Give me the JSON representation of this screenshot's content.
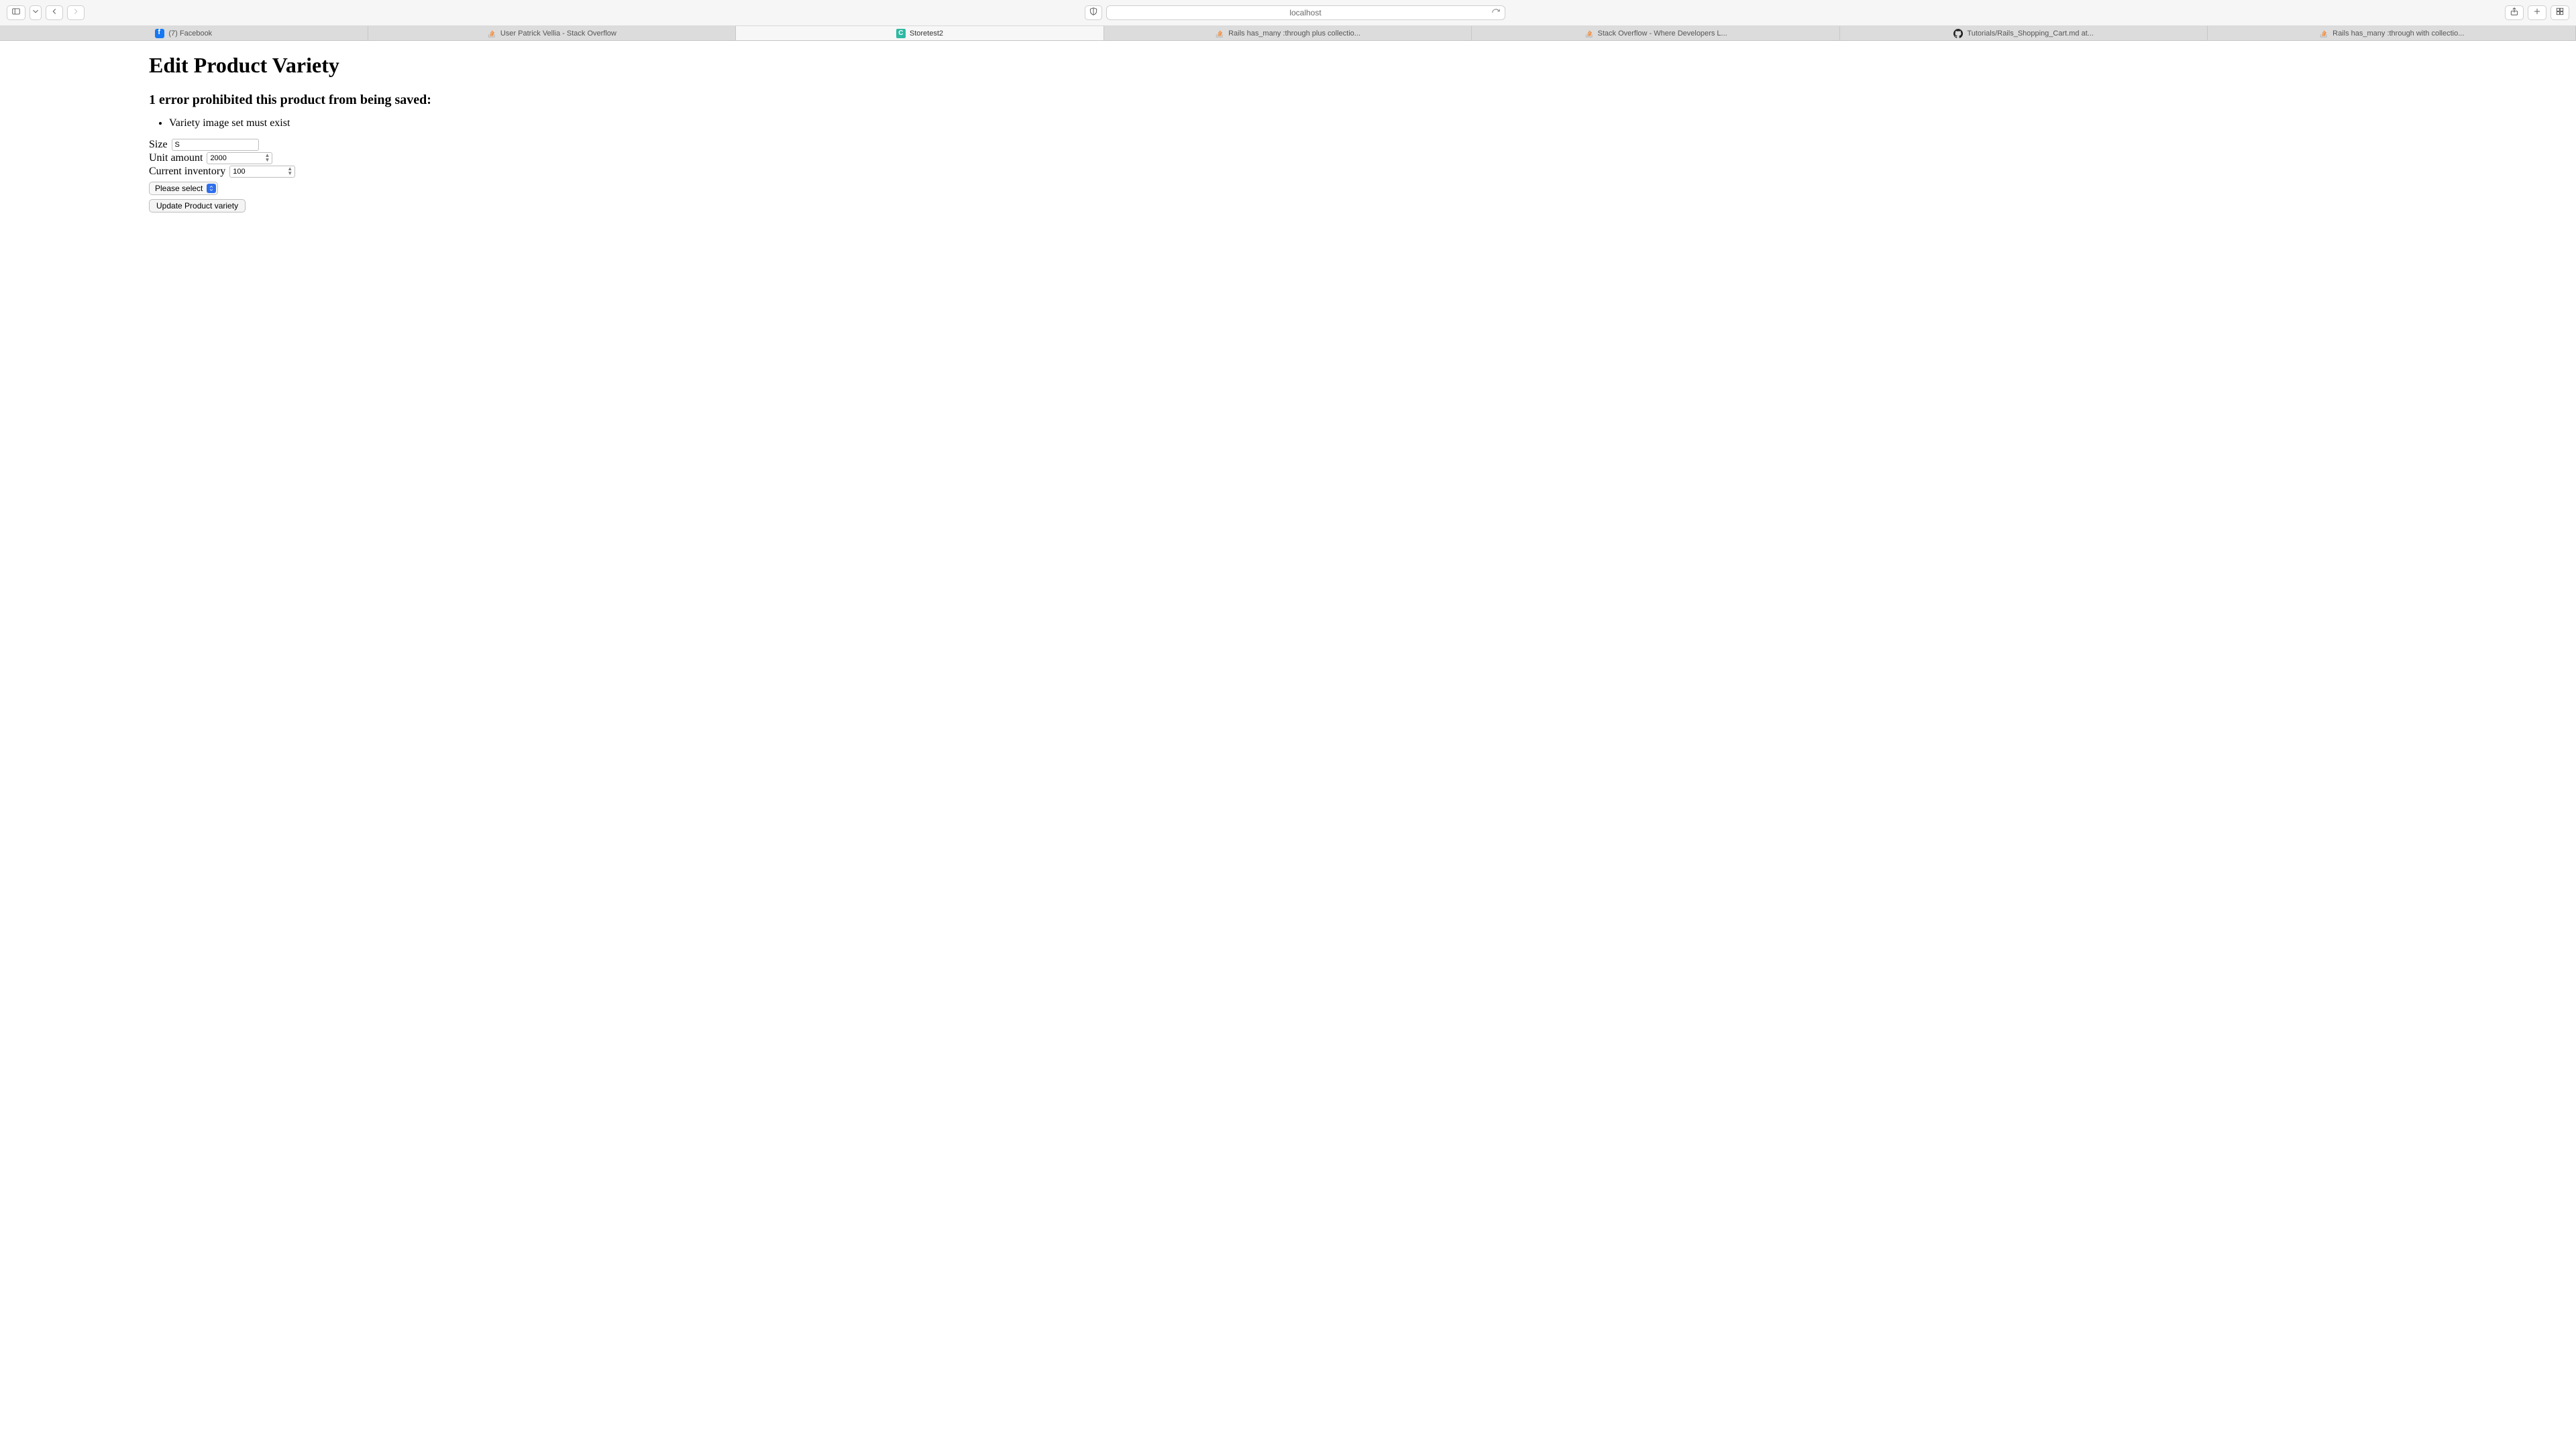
{
  "browser": {
    "address": "localhost"
  },
  "tabs": [
    {
      "label": "(7) Facebook",
      "icon": "facebook",
      "active": false
    },
    {
      "label": "User Patrick Vellia - Stack Overflow",
      "icon": "stackoverflow",
      "active": false
    },
    {
      "label": "Storetest2",
      "icon": "store",
      "active": true
    },
    {
      "label": "Rails has_many :through plus collectio...",
      "icon": "stackoverflow",
      "active": false
    },
    {
      "label": "Stack Overflow - Where Developers L...",
      "icon": "stackoverflow",
      "active": false
    },
    {
      "label": "Tutorials/Rails_Shopping_Cart.md at...",
      "icon": "github",
      "active": false
    },
    {
      "label": "Rails has_many :through with collectio...",
      "icon": "stackoverflow",
      "active": false
    }
  ],
  "page": {
    "title": "Edit Product Variety",
    "error_heading": "1 error prohibited this product from being saved:",
    "errors": [
      "Variety image set must exist"
    ],
    "form": {
      "size_label": "Size",
      "size_value": "S",
      "unit_amount_label": "Unit amount",
      "unit_amount_value": "2000",
      "current_inventory_label": "Current inventory",
      "current_inventory_value": "100",
      "select_placeholder": "Please select",
      "submit_label": "Update Product variety"
    }
  }
}
